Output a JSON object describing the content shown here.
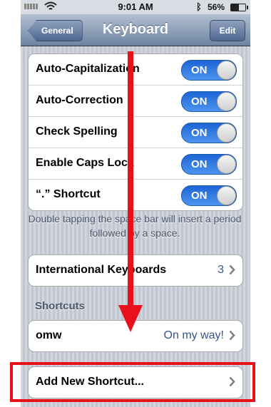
{
  "status_bar": {
    "time": "9:01 AM",
    "battery": "56%",
    "bluetooth_icon": "bluetooth-icon",
    "wifi_icon": "wifi-icon"
  },
  "nav": {
    "back_label": "General",
    "title": "Keyboard",
    "edit_label": "Edit"
  },
  "toggles": [
    {
      "label": "Auto-Capitalization",
      "state": "ON"
    },
    {
      "label": "Auto-Correction",
      "state": "ON"
    },
    {
      "label": "Check Spelling",
      "state": "ON"
    },
    {
      "label": "Enable Caps Lock",
      "state": "ON"
    },
    {
      "label": "“.” Shortcut",
      "state": "ON"
    }
  ],
  "footer_note": "Double tapping the space bar will insert a period followed by a space.",
  "international": {
    "label": "International Keyboards",
    "value": "3"
  },
  "shortcuts": {
    "header": "Shortcuts",
    "items": [
      {
        "phrase": "omw",
        "expansion": "On my way!"
      }
    ],
    "add_label": "Add New Shortcut..."
  },
  "colors": {
    "annotation_red": "#e8101a",
    "switch_blue": "#2f7ae5",
    "nav_top": "#b3bfd1",
    "nav_bottom": "#6d84a2"
  }
}
